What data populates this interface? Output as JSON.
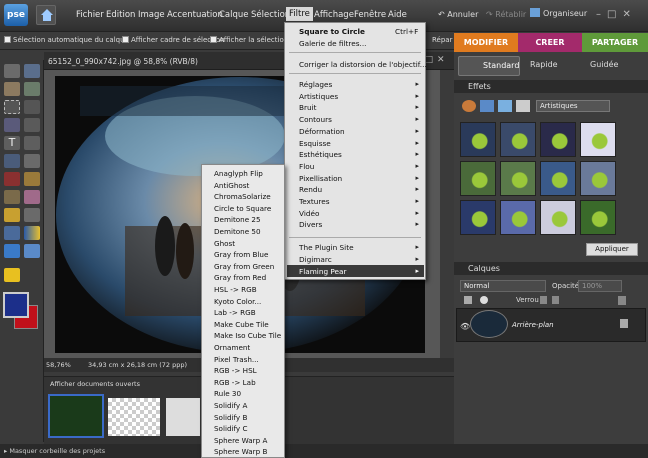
{
  "app": {
    "logo_text": "pse"
  },
  "menubar": {
    "items": [
      "Fichier",
      "Edition",
      "Image",
      "Accentuation",
      "Calque",
      "Sélection",
      "Filtre",
      "Affichage",
      "Fenêtre",
      "Aide"
    ],
    "active": "Filtre",
    "undo_label": "Annuler",
    "redo_label": "Rétablir",
    "organiser_label": "Organiseur"
  },
  "optionsbar": {
    "opt1": "Sélection automatique du calque",
    "opt2": "Afficher cadre de sélection",
    "opt3": "Afficher la sélection au s",
    "opt4": "Répar"
  },
  "modes": {
    "modifier": "MODIFIER",
    "creer": "CREER",
    "partager": "PARTAGER"
  },
  "subtabs": {
    "standard": "Standard",
    "rapide": "Rapide",
    "guidee": "Guidée"
  },
  "document": {
    "title": "65152_0_990x742.jpg @ 58,8% (RVB/8)",
    "zoom": "58,76%",
    "dims": "34,93 cm x 26,18 cm (72 ppp)"
  },
  "projectbin": {
    "title": "Afficher documents ouverts",
    "hide_label": "Masquer corbeille des projets"
  },
  "effects": {
    "title": "Effets",
    "category": "Artistiques",
    "apply_label": "Appliquer"
  },
  "layers": {
    "title": "Calques",
    "blend_mode": "Normal",
    "opacity_label": "Opacité :",
    "opacity_value": "100%",
    "lock_label": "Verrou :",
    "layer_name": "Arrière-plan"
  },
  "filter_menu": {
    "top": [
      {
        "label": "Square to Circle",
        "shortcut": "Ctrl+F"
      },
      {
        "label": "Galerie de filtres...",
        "shortcut": ""
      }
    ],
    "distort": "Corriger la distorsion de l'objectif...",
    "groups": [
      "Réglages",
      "Artistiques",
      "Bruit",
      "Contours",
      "Déformation",
      "Esquisse",
      "Esthétiques",
      "Flou",
      "Pixellisation",
      "Rendu",
      "Textures",
      "Vidéo",
      "Divers"
    ],
    "plugins": [
      "The Plugin Site",
      "Digimarc",
      "Flaming Pear"
    ],
    "highlight": "Flaming Pear"
  },
  "flaming_pear_submenu": [
    "Anaglyph Flip",
    "AntiGhost",
    "ChromaSolarize",
    "Circle to Square",
    "Demitone 25",
    "Demitone 50",
    "Ghost",
    "Gray from Blue",
    "Gray from Green",
    "Gray from Red",
    "HSL -> RGB",
    "Kyoto Color...",
    "Lab -> RGB",
    "Make Cube Tile",
    "Make Iso Cube Tile",
    "Ornament",
    "Pixel Trash...",
    "RGB -> HSL",
    "RGB -> Lab",
    "Rule 30",
    "Solidify A",
    "Solidify B",
    "Solidify C",
    "Sphere Warp A",
    "Sphere Warp B"
  ],
  "colors": {
    "foreground": "#1c2f8a",
    "background": "#c0101a",
    "modifier_tab": "#e07b1f",
    "creer_tab": "#a32a6b",
    "partager_tab": "#5f9a3a",
    "menu_highlight": "#3a3a3a"
  }
}
